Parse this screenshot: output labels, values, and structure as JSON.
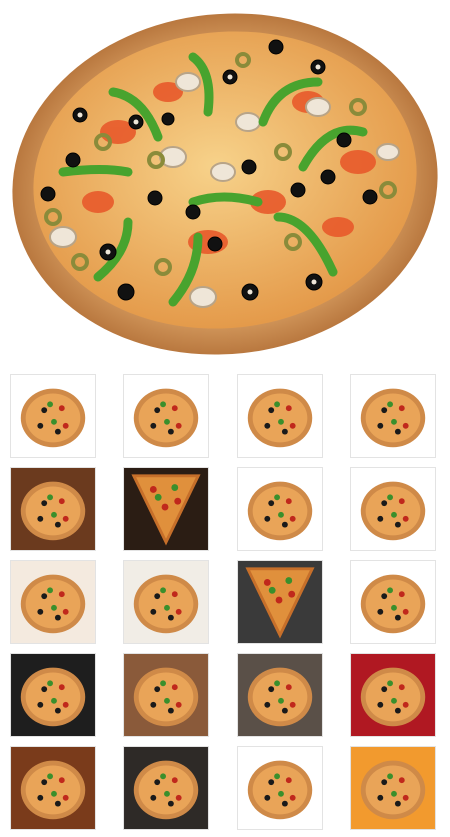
{
  "hero": {
    "subject": "pizza-main-image"
  },
  "gallery": {
    "thumbnails": [
      {
        "kind": "pizza-slice-cut",
        "bg": "#ffffff"
      },
      {
        "kind": "pizza-on-board",
        "bg": "#ffffff"
      },
      {
        "kind": "pizza-on-board-side",
        "bg": "#ffffff"
      },
      {
        "kind": "pizza-whole-veggie",
        "bg": "#ffffff"
      },
      {
        "kind": "pizza-on-table",
        "bg": "#6b3a1e"
      },
      {
        "kind": "pizza-single-slice",
        "bg": "#2b1d14"
      },
      {
        "kind": "pizza-top-down",
        "bg": "#ffffff"
      },
      {
        "kind": "pizza-on-wooden-peel",
        "bg": "#ffffff"
      },
      {
        "kind": "pizza-quarter-mixed",
        "bg": "#f4eadf"
      },
      {
        "kind": "pizza-sliced-apart",
        "bg": "#f1ede6"
      },
      {
        "kind": "pizza-slice-dark",
        "bg": "#3a3a3a"
      },
      {
        "kind": "pizza-peel-side",
        "bg": "#ffffff"
      },
      {
        "kind": "pizza-tomato-dark",
        "bg": "#1e1e1e"
      },
      {
        "kind": "pizza-plate-table",
        "bg": "#8a5a3a"
      },
      {
        "kind": "pizza-slices-stone",
        "bg": "#5a5048"
      },
      {
        "kind": "pizza-red-bg",
        "bg": "#b01822"
      },
      {
        "kind": "pizza-table-close",
        "bg": "#7a3b1b"
      },
      {
        "kind": "pizza-oven",
        "bg": "#2e2a27"
      },
      {
        "kind": "pizza-vegetables",
        "bg": "#ffffff"
      },
      {
        "kind": "pizza-slice-lift",
        "bg": "#f29a2e"
      }
    ]
  }
}
